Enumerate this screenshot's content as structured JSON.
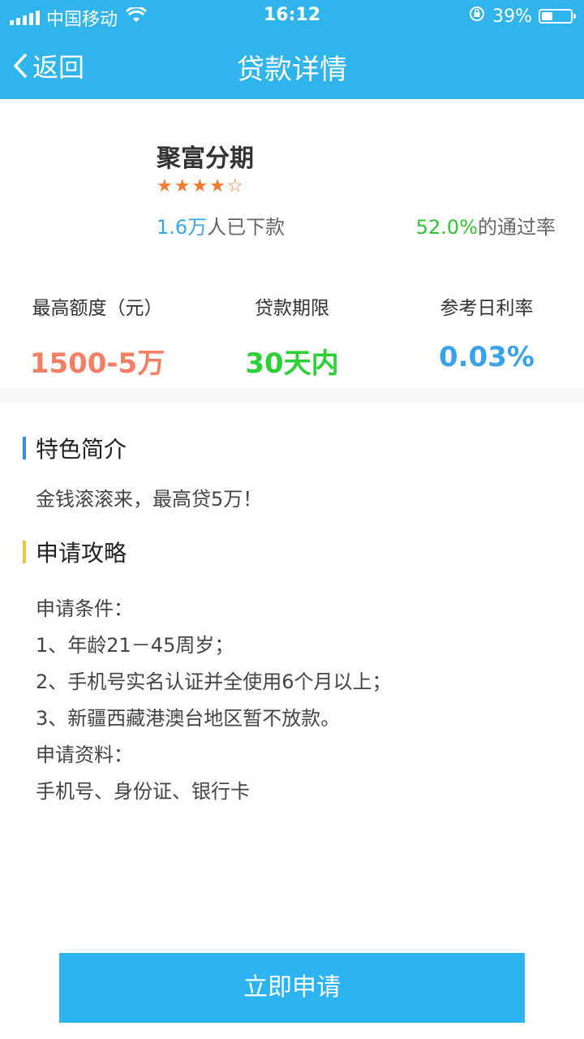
{
  "status_bar": {
    "carrier": "中国移动",
    "time": "16:12",
    "battery_percent": "39%",
    "battery_level": 0.39
  },
  "nav": {
    "back_label": "返回",
    "title": "贷款详情"
  },
  "product": {
    "name": "聚富分期",
    "rating": 4,
    "rating_max": 5,
    "downloads_num": "1.6万",
    "downloads_suffix": "人已下款",
    "pass_rate_num": "52.0%",
    "pass_rate_suffix": "的通过率"
  },
  "metrics": [
    {
      "label": "最高额度（元）",
      "value": "1500-5万",
      "color": "#f47f64"
    },
    {
      "label": "贷款期限",
      "value": "30天内",
      "color": "#2ed03a"
    },
    {
      "label": "参考日利率",
      "value": "0.03%",
      "color": "#3aa2ea"
    }
  ],
  "features": {
    "title": "特色简介",
    "text": "金钱滚滚来，最高贷5万！"
  },
  "guide": {
    "title": "申请攻略",
    "lines": [
      "申请条件：",
      "1、年龄21－45周岁；",
      "2、手机号实名认证并全使用6个月以上；",
      "3、新疆西藏港澳台地区暂不放款。",
      "申请资料：",
      "手机号、身份证、银行卡"
    ]
  },
  "apply_button": "立即申请",
  "colors": {
    "header": "#2fb5ec",
    "button": "#2bb3f2",
    "star": "#f27b2f"
  }
}
